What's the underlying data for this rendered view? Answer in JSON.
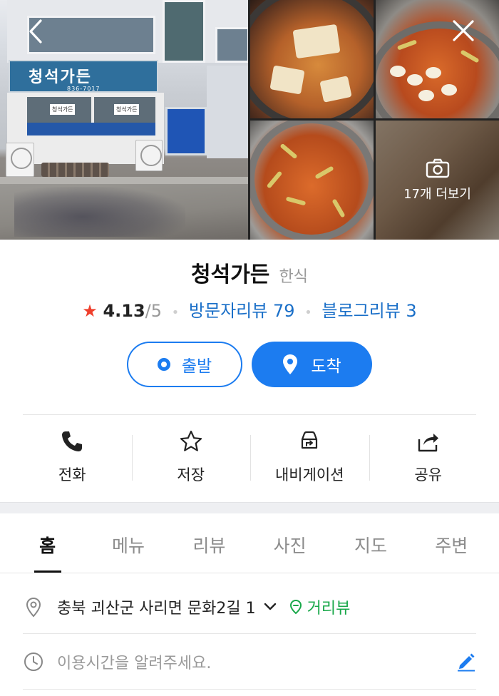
{
  "gallery": {
    "more_label": "17개 더보기",
    "sign_text": "청석가든",
    "sign_phone": "836-7017",
    "back_icon": "chevron-left-icon",
    "close_icon": "close-icon"
  },
  "place": {
    "name": "청석가든",
    "category": "한식",
    "rating": "4.13",
    "rating_out_of": "/5",
    "visitor_reviews": "방문자리뷰 79",
    "blog_reviews": "블로그리뷰 3"
  },
  "route": {
    "depart_label": "출발",
    "arrive_label": "도착"
  },
  "actions": [
    {
      "label": "전화",
      "icon": "phone-icon"
    },
    {
      "label": "저장",
      "icon": "star-outline-icon"
    },
    {
      "label": "내비게이션",
      "icon": "car-navigation-icon"
    },
    {
      "label": "공유",
      "icon": "share-icon"
    }
  ],
  "tabs": [
    {
      "label": "홈",
      "active": true
    },
    {
      "label": "메뉴"
    },
    {
      "label": "리뷰"
    },
    {
      "label": "사진"
    },
    {
      "label": "지도"
    },
    {
      "label": "주변"
    }
  ],
  "info": {
    "address": "충북 괴산군 사리면 문화2길 1",
    "street_view_label": "거리뷰",
    "hours_placeholder": "이용시간을 알려주세요."
  },
  "colors": {
    "primary_blue": "#1c7cf0",
    "link_blue": "#1a6fc8",
    "star_red": "#ef3f2c",
    "street_view_green": "#19a84a"
  }
}
